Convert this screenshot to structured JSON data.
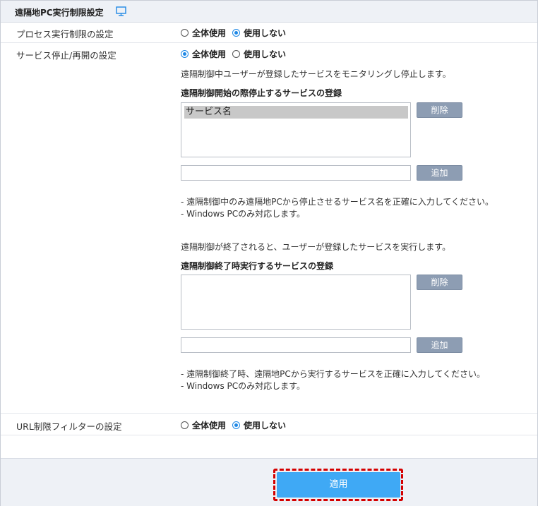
{
  "header": {
    "title": "遠隔地PC実行制限設定",
    "icon": "monitor-icon"
  },
  "process_limit": {
    "label": "プロセス実行制限の設定",
    "opt_all": "全体使用",
    "opt_none": "使用しない",
    "selected": "使用しない"
  },
  "service_stop": {
    "label": "サービス停止/再開の設定",
    "opt_all": "全体使用",
    "opt_none": "使用しない",
    "selected": "全体使用",
    "description": "遠隔制御中ユーザーが登録したサービスをモニタリングし停止します。",
    "start_heading": "遠隔制御開始の際停止するサービスの登録",
    "start_list": [
      "サービス名"
    ],
    "delete_label": "削除",
    "add_label": "追加",
    "start_notes": [
      "- 遠隔制御中のみ遠隔地PCから停止させるサービス名を正確に入力してください。",
      "- Windows PCのみ対応します。"
    ],
    "end_description": "遠隔制御が終了されると、ユーザーが登録したサービスを実行します。",
    "end_heading": "遠隔制御終了時実行するサービスの登録",
    "end_notes": [
      "- 遠隔制御終了時、遠隔地PCから実行するサービスを正確に入力してください。",
      "- Windows PCのみ対応します。"
    ]
  },
  "url_filter": {
    "label": "URL制限フィルターの設定",
    "opt_all": "全体使用",
    "opt_none": "使用しない",
    "selected": "使用しない"
  },
  "footer": {
    "apply_label": "適用"
  },
  "colors": {
    "accent": "#1e88e5",
    "apply": "#3fa9f5",
    "button": "#8d9db3",
    "highlight": "#d40000"
  }
}
